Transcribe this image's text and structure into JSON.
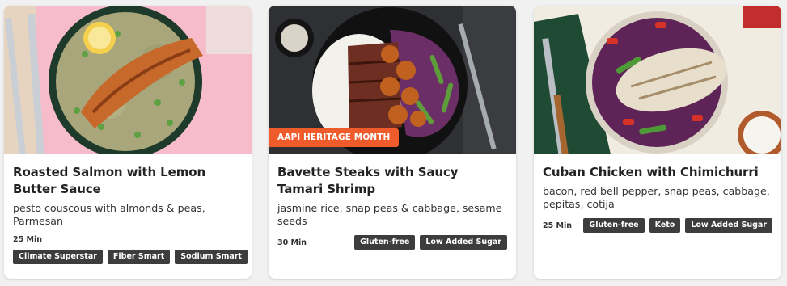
{
  "cards": [
    {
      "title": "Roasted Salmon with Lemon Butter Sauce",
      "description": "pesto couscous with almonds & peas, Parmesan",
      "time": "25 Min",
      "tags": [
        "Climate Superstar",
        "Fiber Smart",
        "Sodium Smart"
      ]
    },
    {
      "badge": "AAPI HERITAGE MONTH",
      "title": "Bavette Steaks with Saucy Tamari Shrimp",
      "description": "jasmine rice, snap peas & cabbage, sesame seeds",
      "time": "30 Min",
      "tags": [
        "Gluten-free",
        "Low Added Sugar"
      ]
    },
    {
      "title": "Cuban Chicken with Chimichurri",
      "description": "bacon, red bell pepper, snap peas, cabbage, pepitas, cotija",
      "time": "25 Min",
      "tags": [
        "Gluten-free",
        "Keto",
        "Low Added Sugar"
      ]
    }
  ],
  "colors": {
    "badge": "#ef5b2a",
    "tag_background": "#3d3d3d",
    "card_background": "#ffffff"
  }
}
